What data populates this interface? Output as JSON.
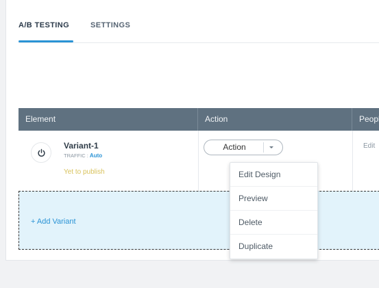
{
  "tabs": [
    {
      "label": "A/B TESTING",
      "active": true
    },
    {
      "label": "SETTINGS",
      "active": false
    }
  ],
  "table": {
    "columns": [
      "Element",
      "Action",
      "People"
    ],
    "rows": [
      {
        "name": "Variant-1",
        "traffic_label": "TRAFFIC : ",
        "traffic_value": "Auto",
        "status": "Yet to publish",
        "action_label": "Action",
        "people_link": "Edit"
      }
    ]
  },
  "add_variant_label": "+ Add Variant",
  "action_menu": {
    "items": [
      "Edit Design",
      "Preview",
      "Delete",
      "Duplicate"
    ]
  },
  "colors": {
    "accent": "#2a93d5",
    "header_bg": "#5f7180",
    "status_yellow": "#d8c25c",
    "add_zone_bg": "#e2f3fb"
  }
}
